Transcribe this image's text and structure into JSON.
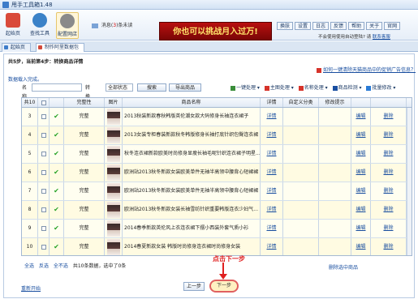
{
  "window": {
    "title": "甩手工具箱1.48"
  },
  "toolbar": {
    "buttons": [
      {
        "label": "起始页",
        "icon": "home-icon",
        "color": "#d94a3a"
      },
      {
        "label": "查找工具",
        "icon": "search-icon",
        "color": "#3b82c8"
      },
      {
        "label": "配置网店",
        "icon": "gear-icon",
        "color": "#8a8a8a"
      }
    ],
    "msg_prefix": "消息(",
    "msg_count": "3",
    "msg_suffix": ")条未读",
    "banner": "你也可以挑战月入过万!",
    "top_buttons": [
      "换肤",
      "设置",
      "日志",
      "反馈",
      "帮助",
      "关于",
      "官网"
    ],
    "autologin": "不会使用使用自动登陆? 请",
    "autologin_link": "联系客服"
  },
  "tabs": [
    "起始页",
    "制作阿里数据包"
  ],
  "steps": "共5步，当前第4步：转换商品详情",
  "ad_link": "如何一键清除天猫商品中的促销广告信息？",
  "load_ok": "数据载入完成。",
  "filter": {
    "name_label": "名称",
    "status_label": "转换状态",
    "status_value": "全部状态",
    "search": "搜索",
    "export": "导出商品"
  },
  "actions": [
    {
      "label": "一键处理",
      "color": "#3a8d3a"
    },
    {
      "label": "主图处理",
      "color": "#d6332a"
    },
    {
      "label": "名称处理",
      "color": "#d6332a"
    },
    {
      "label": "商品检测",
      "color": "#1a4fa0"
    },
    {
      "label": "批量修改",
      "color": "#2a7bd6"
    }
  ],
  "grid": {
    "headers": {
      "total": "共10",
      "check": "",
      "status": "完整性",
      "image": "图片",
      "name": "商品名称",
      "detail": "详情",
      "category": "自定义分类",
      "hint": "修改提示"
    },
    "rows": [
      {
        "id": "3",
        "status": "完整",
        "name": "2013秋装新款春秋韩版英伦潮女款大码修身长袖连衣裙子",
        "detail": "详情",
        "edit": "编辑",
        "delete": "删除"
      },
      {
        "id": "4",
        "status": "完整",
        "name": "2013女装专柜春装新款秋冬韩版修身长袖打底针织包臀连衣裙",
        "detail": "详情",
        "edit": "编辑",
        "delete": "删除"
      },
      {
        "id": "5",
        "status": "完整",
        "name": "秋冬连衣裙新款欧美时尚修身显瘦长袖毛呢针织连衣裙子明星...",
        "detail": "详情",
        "edit": "编辑",
        "delete": "删除"
      },
      {
        "id": "6",
        "status": "完整",
        "name": "欧洲站2013秋冬新款女装欧美单件无袖半高领中腰背心短裙裙",
        "detail": "详情",
        "edit": "编辑",
        "delete": "删除"
      },
      {
        "id": "7",
        "status": "完整",
        "name": "欧洲站2013秋冬新款女装欧美单件无袖半高领中腰背心短裙裙",
        "detail": "详情",
        "edit": "编辑",
        "delete": "删除"
      },
      {
        "id": "8",
        "status": "完整",
        "name": "欧洲站2013秋冬新款女装长袖雪纺针织重要韩版连衣少妇气...",
        "detail": "详情",
        "edit": "编辑",
        "delete": "删除"
      },
      {
        "id": "9",
        "status": "完整",
        "name": "2014春季新款英伦风上衣连衣裙下摆小西装外套气质小衫",
        "detail": "详情",
        "edit": "编辑",
        "delete": "删除"
      },
      {
        "id": "10",
        "status": "完整",
        "name": "2014春夏新款女装 韩版时尚修身连衣裙时尚修身女装",
        "detail": "详情",
        "edit": "编辑",
        "delete": "删除"
      }
    ]
  },
  "footer": {
    "select_all": "全选",
    "invert": "反选",
    "select_none": "全不选",
    "count_text": "共10条数据，选中了0条",
    "annotation": "点击下一步",
    "right_link": "删除选中商品",
    "restart": "重新开始",
    "prev": "上一步",
    "next": "下一步"
  }
}
